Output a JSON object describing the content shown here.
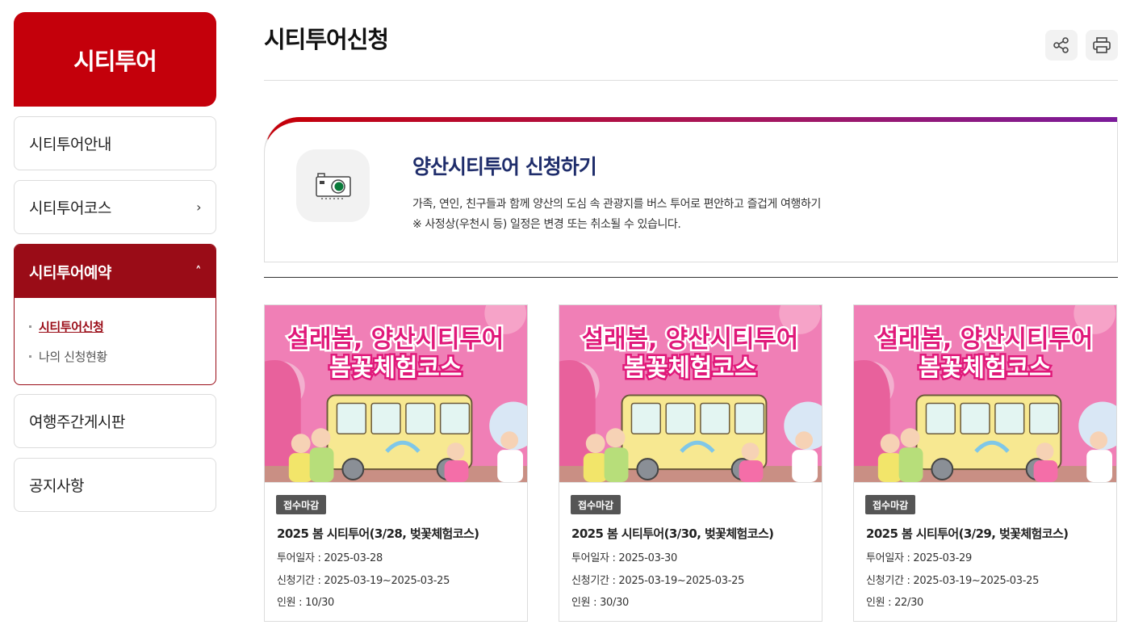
{
  "sidebar": {
    "title": "시티투어",
    "menu": [
      {
        "label": "시티투어안내"
      },
      {
        "label": "시티투어코스",
        "chevron": "›"
      },
      {
        "label": "시티투어예약",
        "chevron": "˄"
      },
      {
        "label": "여행주간게시판"
      },
      {
        "label": "공지사항"
      }
    ],
    "submenu": [
      {
        "label": "시티투어신청",
        "active": true
      },
      {
        "label": "나의 신청현황",
        "active": false
      }
    ]
  },
  "page": {
    "title": "시티투어신청",
    "tools": [
      "share-icon",
      "print-icon"
    ]
  },
  "intro": {
    "icon": "camera-icon",
    "title": "양산시티투어 신청하기",
    "desc_line1": "가족, 연인, 친구들과 함께 양산의 도심 속 관광지를 버스 투어로 편안하고 즐겁게 여행하기",
    "desc_line2": "※ 사정상(우천시 등) 일정은 변경 또는 취소될 수 있습니다."
  },
  "banner": {
    "line1": "설래봄, 양산시티투어",
    "line2": "봄꽃체험코스"
  },
  "cards": [
    {
      "badge": "접수마감",
      "title": "2025 봄 시티투어(3/28, 벚꽃체험코스)",
      "tour_date": "투어일자 : 2025-03-28",
      "period": "신청기간 : 2025-03-19~2025-03-25",
      "people": "인원 : 10/30"
    },
    {
      "badge": "접수마감",
      "title": "2025 봄 시티투어(3/30, 벚꽃체험코스)",
      "tour_date": "투어일자 : 2025-03-30",
      "period": "신청기간 : 2025-03-19~2025-03-25",
      "people": "인원 : 30/30"
    },
    {
      "badge": "접수마감",
      "title": "2025 봄 시티투어(3/29, 벚꽃체험코스)",
      "tour_date": "투어일자 : 2025-03-29",
      "period": "신청기간 : 2025-03-19~2025-03-25",
      "people": "인원 : 22/30"
    }
  ],
  "colors": {
    "brand": "#c4000b",
    "brand_dark": "#9a0c17",
    "navy": "#1f2d6b",
    "badge": "#555555"
  }
}
